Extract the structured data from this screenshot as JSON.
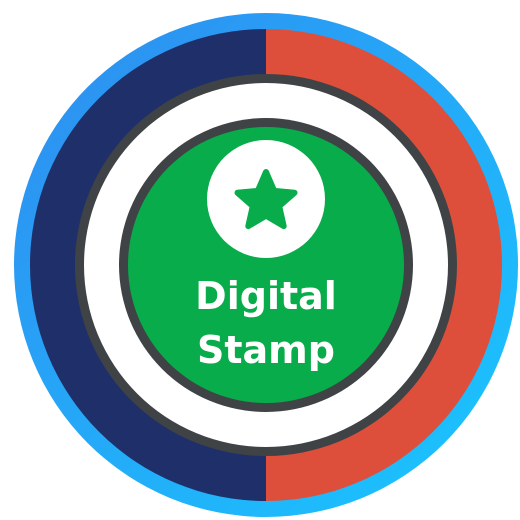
{
  "emblem": {
    "title_line1": "Digital",
    "title_line2": "Stamp",
    "icon": "star-icon",
    "colors": {
      "outer_ring_gradient_start": "#2f8cf0",
      "outer_ring_gradient_end": "#19c7ff",
      "left_half": "#1f2f6a",
      "right_half": "#dd4f3b",
      "dark_ring": "#3f4346",
      "white_ring": "#ffffff",
      "center_fill": "#09ac4a",
      "icon_circle": "#ffffff",
      "star": "#09ac4a",
      "text": "#ffffff"
    }
  }
}
